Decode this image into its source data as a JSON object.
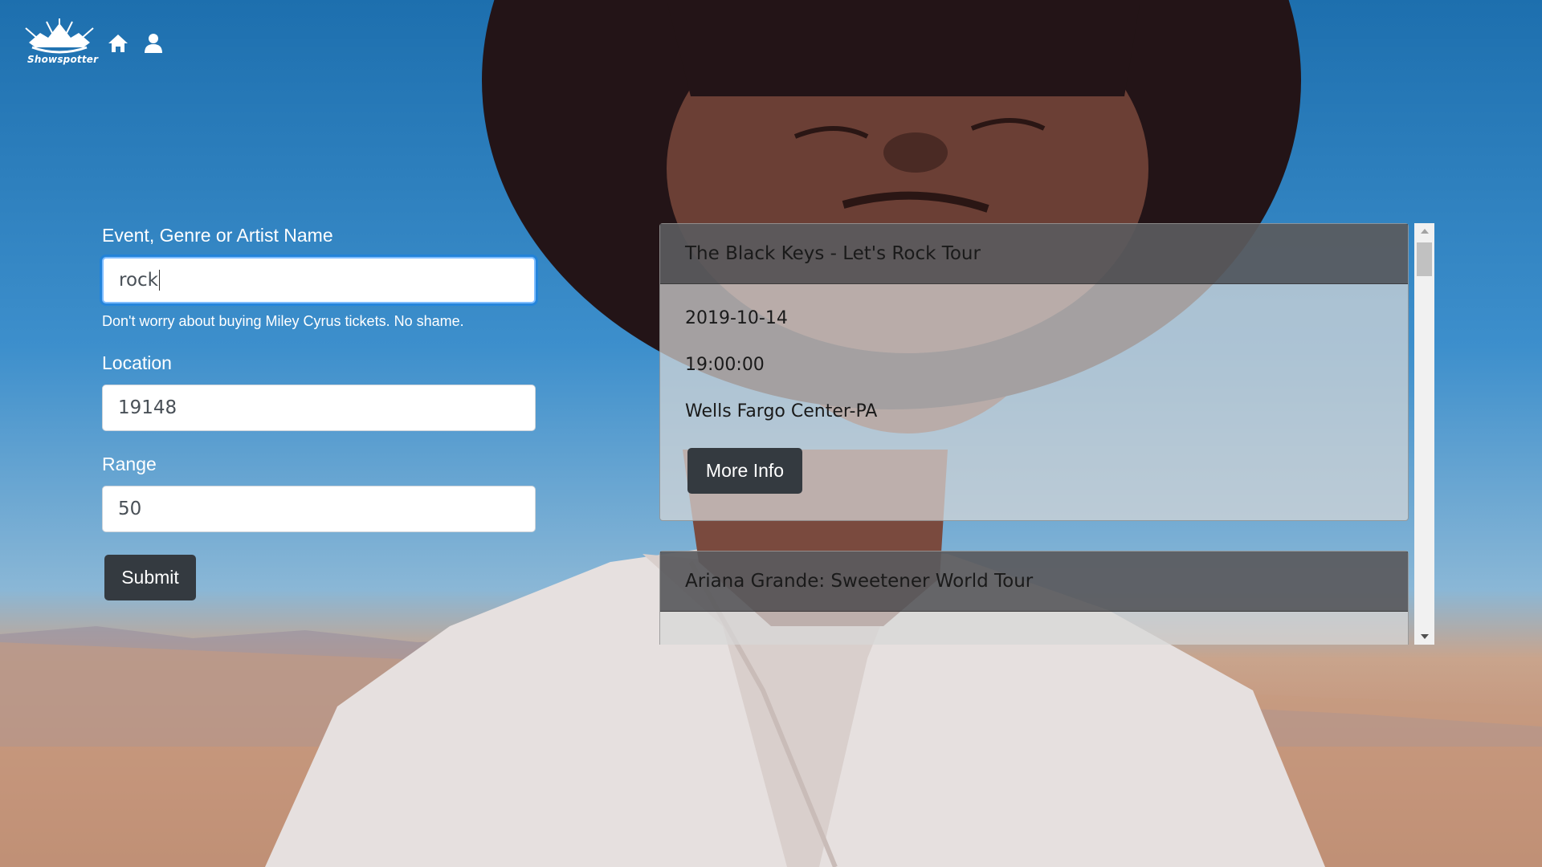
{
  "brand": {
    "name": "Showspotter"
  },
  "nav": {
    "home_icon": "home-icon",
    "user_icon": "user-icon"
  },
  "form": {
    "query_label": "Event, Genre or Artist Name",
    "query_value": "rock",
    "query_help": "Don't worry about buying Miley Cyrus tickets. No shame.",
    "location_label": "Location",
    "location_value": "19148",
    "range_label": "Range",
    "range_value": "50",
    "submit_label": "Submit"
  },
  "results": [
    {
      "title": "The Black Keys - Let's Rock Tour",
      "date": "2019-10-14",
      "time": "19:00:00",
      "venue": "Wells Fargo Center-PA",
      "button_label": "More Info"
    },
    {
      "title": "Ariana Grande: Sweetener World Tour"
    }
  ],
  "colors": {
    "button": "#343a40",
    "focus": "#80bdff",
    "card_header": "#37373c"
  }
}
